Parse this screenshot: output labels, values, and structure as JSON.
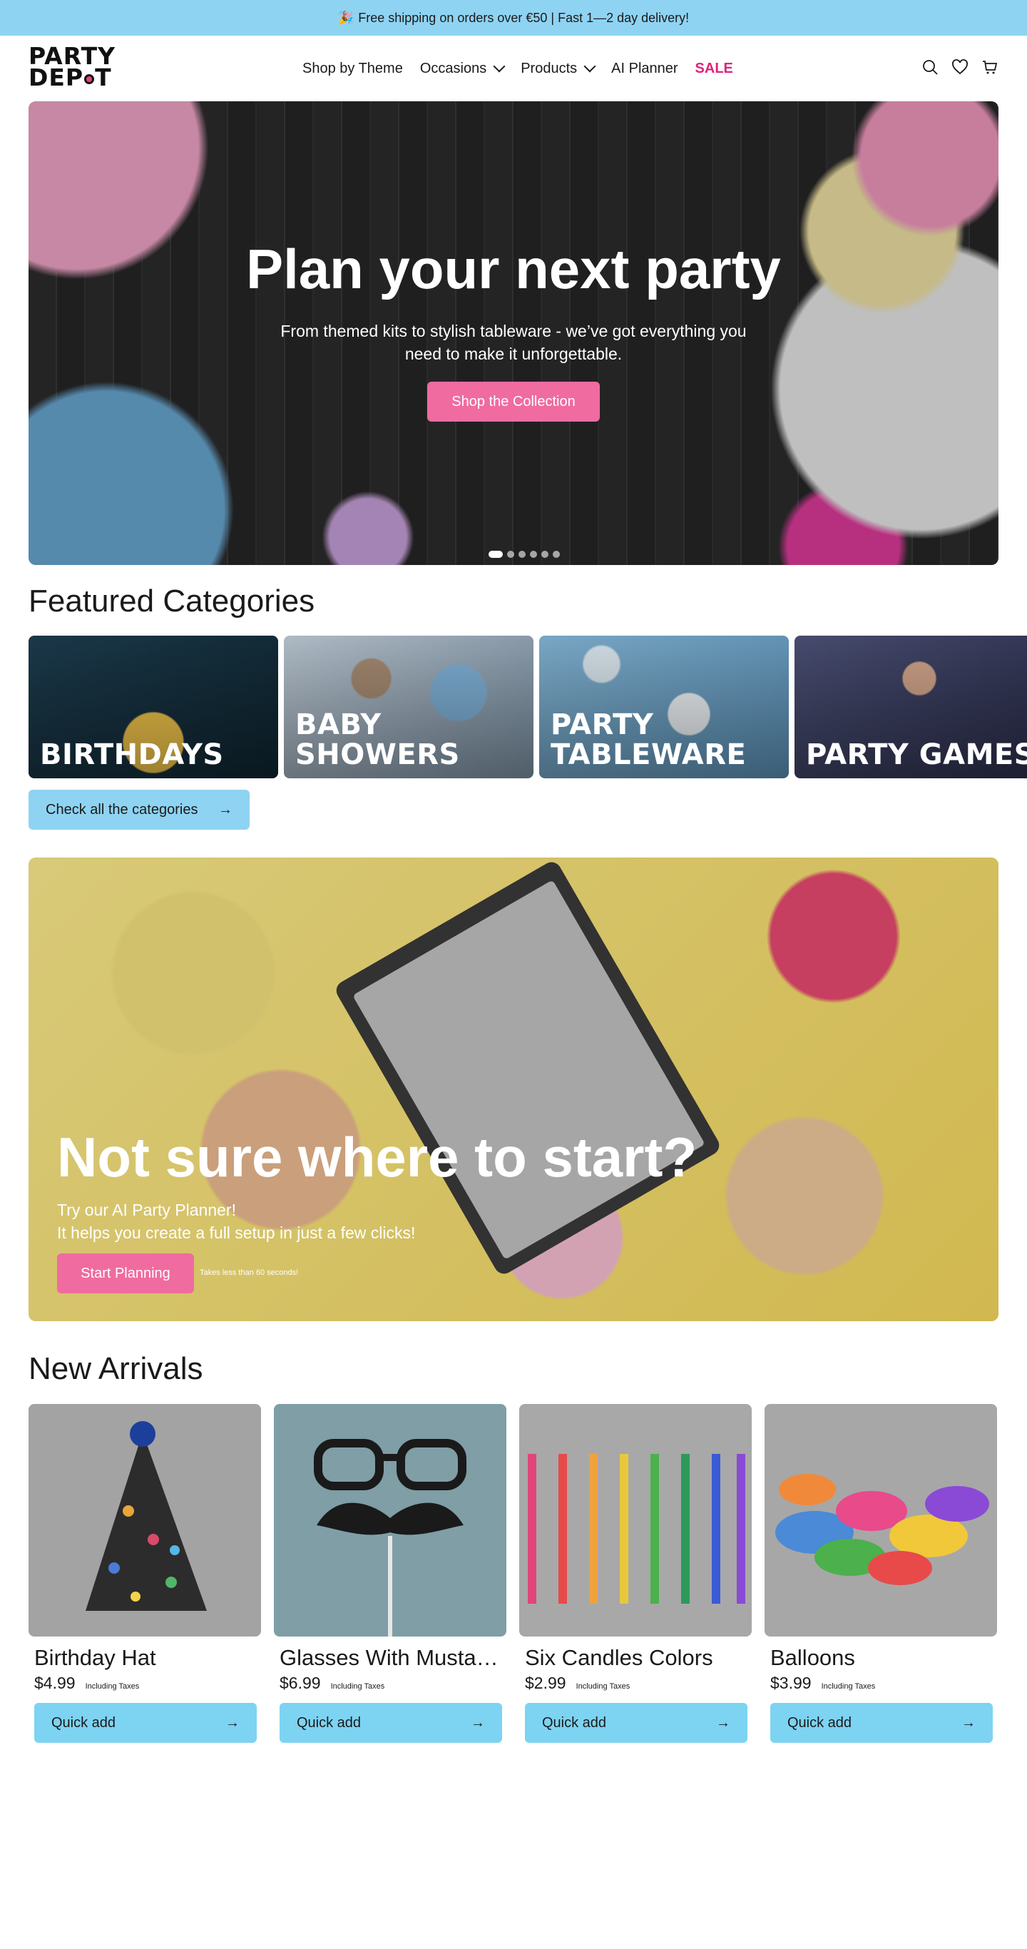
{
  "announcement": {
    "icon": "🎉",
    "text": "Free shipping on orders over €50 | Fast 1—2 day delivery!"
  },
  "logo": {
    "line1": "PARTY",
    "line2a": "DEP",
    "line2b": "T"
  },
  "nav": {
    "items": [
      {
        "label": "Shop by Theme"
      },
      {
        "label": "Occasions"
      },
      {
        "label": "Products"
      },
      {
        "label": "AI Planner"
      },
      {
        "label": "SALE"
      }
    ]
  },
  "colors": {
    "accent_blue": "#8fd3f2",
    "accent_pink": "#f06ba0",
    "sale_pink": "#e0227a"
  },
  "hero": {
    "title": "Plan your next party",
    "subtitle": "From themed kits to stylish tableware - we’ve got everything you need to make it unforgettable.",
    "button": "Shop the Collection",
    "slide_count": 6,
    "active_slide": 1
  },
  "featured": {
    "title": "Featured Categories",
    "categories": [
      {
        "label": "BIRTHDAYS"
      },
      {
        "label": "BABY SHOWERS"
      },
      {
        "label": "PARTY TABLEWARE"
      },
      {
        "label": "PARTY GAMES"
      }
    ],
    "button": "Check all the categories"
  },
  "planner": {
    "title": "Not sure where to start?",
    "line1": "Try our AI Party Planner!",
    "line2": "It helps you create a full setup in just a few clicks!",
    "button": "Start Planning",
    "note": "Takes less than 60 seconds!"
  },
  "arrivals": {
    "title": "New Arrivals",
    "quick_add": "Quick add",
    "tax_note": "Including Taxes",
    "products": [
      {
        "name": "Birthday Hat",
        "price": "$4.99"
      },
      {
        "name": "Glasses With Mustache",
        "price": "$6.99"
      },
      {
        "name": "Six Candles Colors",
        "price": "$2.99"
      },
      {
        "name": "Balloons",
        "price": "$3.99"
      }
    ]
  }
}
